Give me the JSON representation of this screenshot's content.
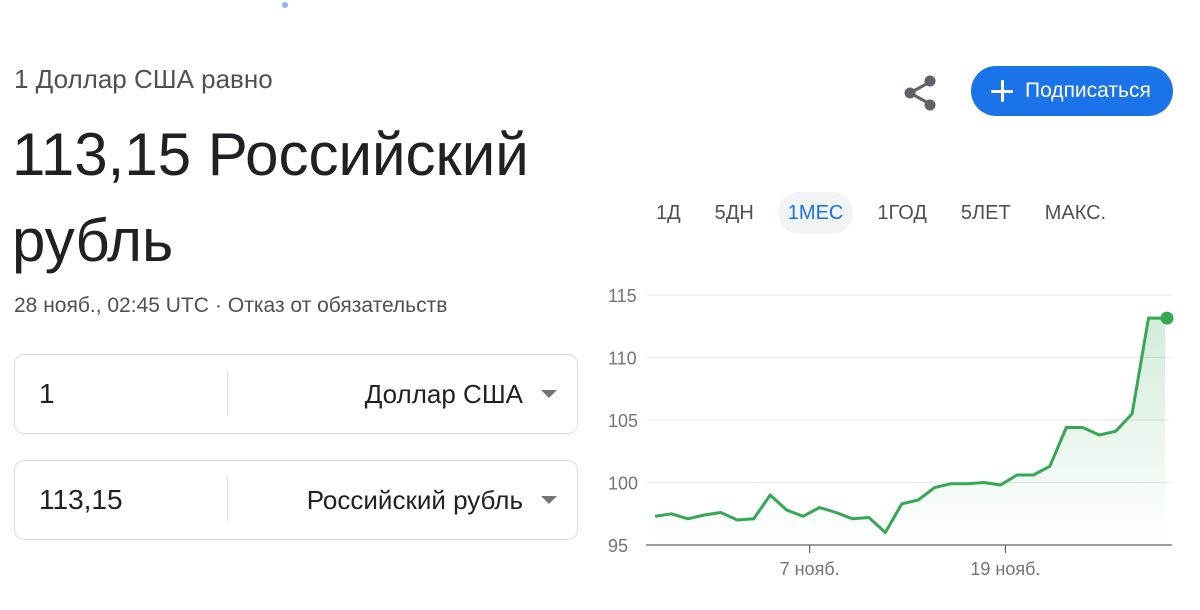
{
  "header": {
    "subtitle": "1 Доллар США равно",
    "value_line": "113,15 Российский рубль",
    "timestamp": "28 нояб., 02:45 UTC",
    "separator": "·",
    "disclaimer": "Отказ от обязательств"
  },
  "actions": {
    "share_icon": "share-icon",
    "subscribe_label": "Подписаться"
  },
  "converter": {
    "from": {
      "amount": "1",
      "currency": "Доллар США"
    },
    "to": {
      "amount": "113,15",
      "currency": "Российский рубль"
    }
  },
  "tabs": [
    {
      "label": "1Д",
      "active": false
    },
    {
      "label": "5ДН",
      "active": false
    },
    {
      "label": "1МЕС",
      "active": true
    },
    {
      "label": "1ГОД",
      "active": false
    },
    {
      "label": "5ЛЕТ",
      "active": false
    },
    {
      "label": "МАКС.",
      "active": false
    }
  ],
  "colors": {
    "line": "#34a853",
    "accent": "#1a73e8",
    "grid": "#e8eaed",
    "axis": "#5f6368"
  },
  "chart_data": {
    "type": "area",
    "ylim": [
      95,
      115
    ],
    "yticks": [
      95,
      100,
      105,
      110,
      115
    ],
    "xtick_labels": [
      "7 нояб.",
      "19 нояб."
    ],
    "xtick_positions": [
      9.4,
      21.3
    ],
    "x": [
      0,
      1,
      2,
      3,
      4,
      5,
      6,
      7,
      8,
      9,
      10,
      11,
      12,
      13,
      14,
      15,
      16,
      17,
      18,
      19,
      20,
      21,
      22,
      23,
      24,
      25,
      26,
      27,
      28,
      29,
      30,
      31
    ],
    "series": [
      {
        "values": [
          97.3,
          97.5,
          97.1,
          97.4,
          97.6,
          97.0,
          97.1,
          99.0,
          97.8,
          97.3,
          98.0,
          97.6,
          97.1,
          97.2,
          96.0,
          98.3,
          98.6,
          99.6,
          99.9,
          99.9,
          100.0,
          99.8,
          100.6,
          100.6,
          101.3,
          104.4,
          104.4,
          103.8,
          104.1,
          105.5,
          113.15,
          113.15
        ]
      }
    ],
    "grid": true
  }
}
